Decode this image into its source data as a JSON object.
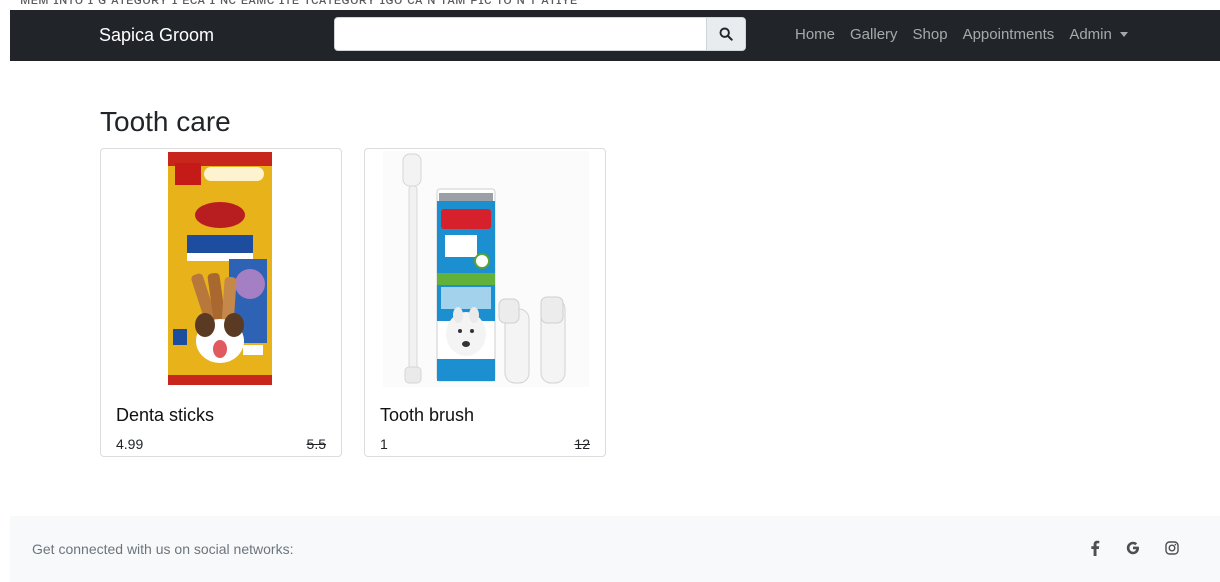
{
  "navbar": {
    "brand": "Sapica Groom",
    "search_value": "",
    "links": [
      "Home",
      "Gallery",
      "Shop",
      "Appointments"
    ],
    "dropdown_label": "Admin"
  },
  "page": {
    "heading": "Tooth care"
  },
  "products": [
    {
      "name": "Denta sticks",
      "price": "4.99",
      "old_price": "5.5"
    },
    {
      "name": "Tooth brush",
      "price": "1",
      "old_price": "12"
    }
  ],
  "footer": {
    "text": "Get connected with us on social networks:",
    "icons": [
      "facebook-icon",
      "google-icon",
      "instagram-icon"
    ]
  },
  "colors": {
    "navbar_bg": "#212529",
    "footer_bg": "#f8f9fa"
  }
}
